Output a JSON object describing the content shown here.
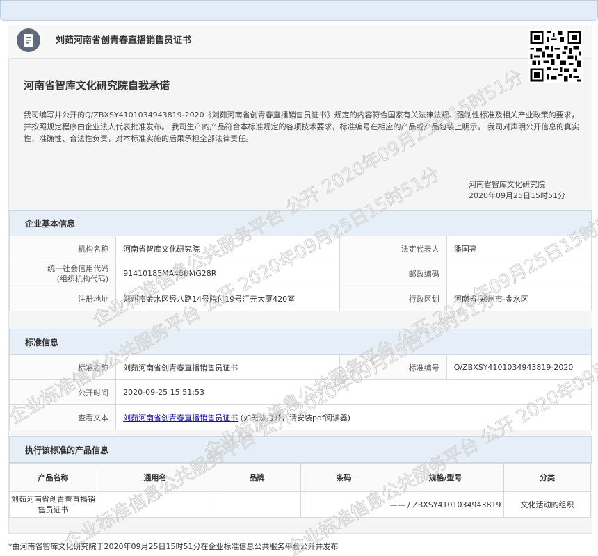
{
  "page": {
    "title": "刘茹河南省创青春直播销售员证书"
  },
  "commitment": {
    "title": "河南省智库文化研究院自我承诺",
    "text": "我司编写并公开的Q/ZBXSY4101034943819-2020《刘茹河南省创青春直播销售员证书》规定的内容符合国家有关法律法规、强制性标准及相关产业政策的要求，并按照规定程序由企业法人代表批准发布。 我司生产的产品符合本标准规定的各项技术要求，标准编号在相应的产品或产品包装上明示。 我司对声明公开信息的真实性、准确性、合法性负责，对本标准实施的后果承担全部法律责任。",
    "signature_org": "河南省智库文化研究院",
    "signature_date": "2020年09月25日15时51分"
  },
  "company": {
    "section_title": "企业基本信息",
    "org_name_label": "机构名称",
    "org_name": "河南省智库文化研究院",
    "legal_rep_label": "法定代表人",
    "legal_rep": "潘国亮",
    "credit_code_label_1": "统一社会信用代码",
    "credit_code_label_2": "(组织机构代码)",
    "credit_code": "91410185MA46BMG28R",
    "postcode_label": "邮政编码",
    "postcode": "",
    "address_label": "注册地址",
    "address": "郑州市金水区经八路14号院付19号汇元大厦420室",
    "region_label": "行政区划",
    "region": "河南省-郑州市-金水区"
  },
  "standard": {
    "section_title": "标准信息",
    "name_label": "标准名称",
    "name": "刘茹河南省创青春直播销售员证书",
    "number_label": "标准编号",
    "number": "Q/ZBXSY4101034943819-2020",
    "publish_time_label": "公开时间",
    "publish_time": "2020-09-25 15:51:53",
    "text_label": "查看文本",
    "text_link": "刘茹河南省创青春直播销售员证书",
    "text_note": "(如无法打开，请安装pdf阅读器)"
  },
  "products": {
    "section_title": "执行该标准的产品信息",
    "columns": [
      "产品名称",
      "通用名",
      "品牌",
      "条码",
      "规格/型号",
      "分类"
    ],
    "rows": [
      [
        "刘茹河南省创青春直播销售员证书",
        "",
        "",
        "",
        "—— / ZBXSY4101034943819",
        "文化活动的组织"
      ]
    ]
  },
  "footer": "*由河南省智库文化研究院于2020年09月25日15时51分在企业标准信息公共服务平台公开并发布",
  "watermark": "企业标准信息公共服务平台 公开 2020年09月25日15时51分"
}
